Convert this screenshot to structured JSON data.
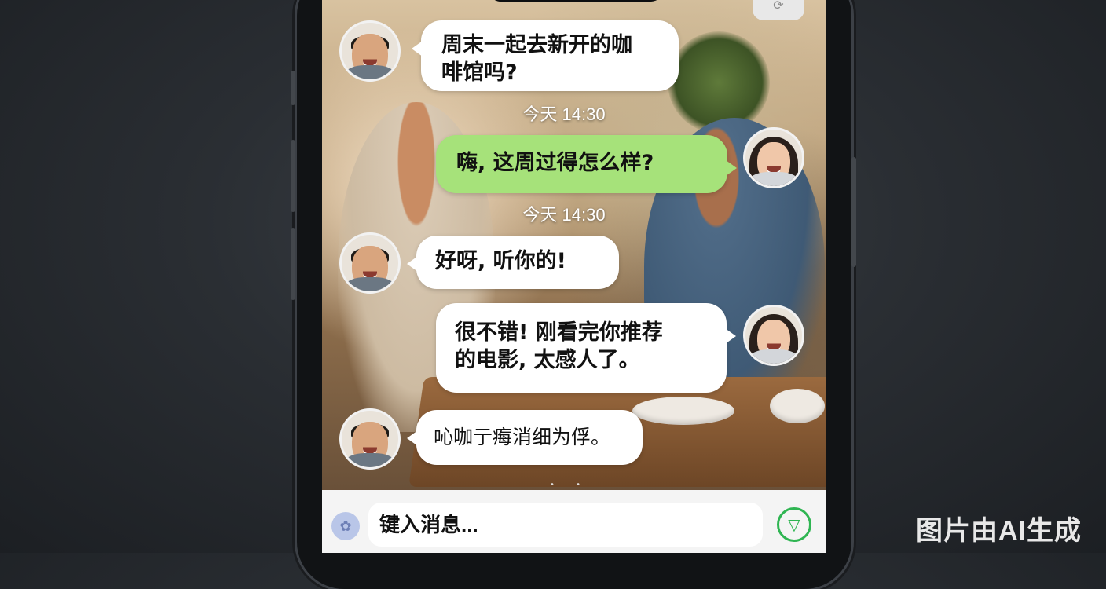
{
  "chat": {
    "messages": [
      {
        "side": "left",
        "text_lines": [
          "周末一起去新开的咖",
          "啡馆吗?"
        ]
      },
      {
        "timestamp": "今天 14:30"
      },
      {
        "side": "right",
        "text_lines": [
          "嗨, 这周过得怎么样?"
        ]
      },
      {
        "timestamp": "今天 14:30"
      },
      {
        "side": "left",
        "text_lines": [
          "好呀, 听你的!"
        ]
      },
      {
        "side": "right",
        "text_lines": [
          "很不错! 刚看完你推荐",
          "的电影, 太感人了。"
        ]
      },
      {
        "side": "left",
        "text_lines": [
          "吣咖亍痗消细为俘。"
        ]
      }
    ]
  },
  "input": {
    "placeholder": "键入消息...",
    "left_icon": "sticker-icon",
    "send_icon": "filter-send-icon"
  },
  "watermark": "图片由AI生成",
  "colors": {
    "outgoing_bubble": "#a6e27a",
    "incoming_bubble": "#ffffff",
    "send_accent": "#2fb552"
  }
}
